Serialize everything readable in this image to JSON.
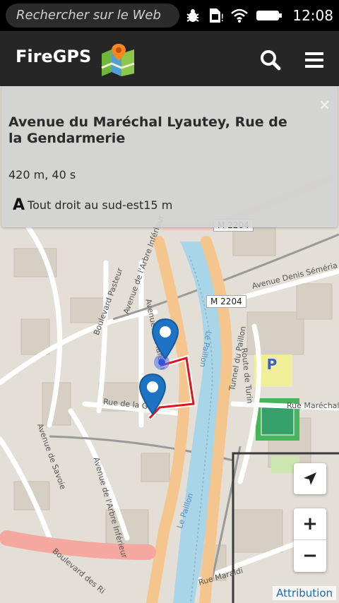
{
  "statusbar": {
    "search_placeholder": "Rechercher sur le Web",
    "icons": [
      "bug-icon",
      "sim-icon",
      "wifi-icon",
      "battery-icon"
    ],
    "time": "12:08"
  },
  "appbar": {
    "title": "FireGPS",
    "logo": "map-logo-icon",
    "search_icon": "search-icon",
    "menu_icon": "hamburger-menu-icon"
  },
  "instruction_panel": {
    "close": "×",
    "title": "Avenue du Maréchal Lyautey, Rue de la Gendarmerie",
    "summary": "420 m, 40 s",
    "step_marker": "A",
    "step_text": "Tout droit au sud-est15 m"
  },
  "map": {
    "labels": {
      "m2204_top": "M 2204",
      "m2204": "M 2204",
      "avenue_denis": "Avenue Denis Séméria",
      "avenue_marechal": "Avenue du Maréch",
      "le_paillon": "Le Paillon",
      "tunnel_paillon": "Tunnel du Paillon",
      "route_turin": "Route de Turin",
      "rue_marechal": "Rue Maréchal",
      "rue_gendarmerie": "Rue de la Ge",
      "boulevard_pasteur": "Boulevard Pasteur",
      "avenue_arbre": "Avenue de l'Arbre Inférieur",
      "avenue_savoie": "Avenue de Savoie",
      "avenue_arbre2": "Avenue de l'Arbre Inférieur",
      "le_paillon2": "Le Paillon",
      "boulevard_ri": "Boulevard des Ri",
      "rue_maraldi": "Rue Maraldi",
      "parking": "P"
    },
    "route_color": "#e0141e",
    "marker_color": "#1f73c4"
  },
  "controls": {
    "locate": "navigation-arrow-icon",
    "zoom_in": "+",
    "zoom_out": "−",
    "attribution": "Attribution"
  }
}
